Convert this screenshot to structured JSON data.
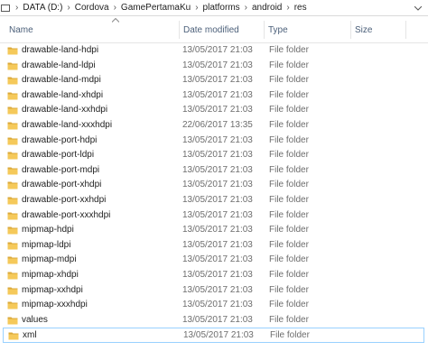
{
  "breadcrumb": [
    "DATA (D:)",
    "Cordova",
    "GamePertamaKu",
    "platforms",
    "android",
    "res"
  ],
  "columns": {
    "name": "Name",
    "date": "Date modified",
    "type": "Type",
    "size": "Size"
  },
  "rows": [
    {
      "name": "drawable-land-hdpi",
      "date": "13/05/2017 21:03",
      "type": "File folder"
    },
    {
      "name": "drawable-land-ldpi",
      "date": "13/05/2017 21:03",
      "type": "File folder"
    },
    {
      "name": "drawable-land-mdpi",
      "date": "13/05/2017 21:03",
      "type": "File folder"
    },
    {
      "name": "drawable-land-xhdpi",
      "date": "13/05/2017 21:03",
      "type": "File folder"
    },
    {
      "name": "drawable-land-xxhdpi",
      "date": "13/05/2017 21:03",
      "type": "File folder"
    },
    {
      "name": "drawable-land-xxxhdpi",
      "date": "22/06/2017 13:35",
      "type": "File folder"
    },
    {
      "name": "drawable-port-hdpi",
      "date": "13/05/2017 21:03",
      "type": "File folder"
    },
    {
      "name": "drawable-port-ldpi",
      "date": "13/05/2017 21:03",
      "type": "File folder"
    },
    {
      "name": "drawable-port-mdpi",
      "date": "13/05/2017 21:03",
      "type": "File folder"
    },
    {
      "name": "drawable-port-xhdpi",
      "date": "13/05/2017 21:03",
      "type": "File folder"
    },
    {
      "name": "drawable-port-xxhdpi",
      "date": "13/05/2017 21:03",
      "type": "File folder"
    },
    {
      "name": "drawable-port-xxxhdpi",
      "date": "13/05/2017 21:03",
      "type": "File folder"
    },
    {
      "name": "mipmap-hdpi",
      "date": "13/05/2017 21:03",
      "type": "File folder"
    },
    {
      "name": "mipmap-ldpi",
      "date": "13/05/2017 21:03",
      "type": "File folder"
    },
    {
      "name": "mipmap-mdpi",
      "date": "13/05/2017 21:03",
      "type": "File folder"
    },
    {
      "name": "mipmap-xhdpi",
      "date": "13/05/2017 21:03",
      "type": "File folder"
    },
    {
      "name": "mipmap-xxhdpi",
      "date": "13/05/2017 21:03",
      "type": "File folder"
    },
    {
      "name": "mipmap-xxxhdpi",
      "date": "13/05/2017 21:03",
      "type": "File folder"
    },
    {
      "name": "values",
      "date": "13/05/2017 21:03",
      "type": "File folder"
    },
    {
      "name": "xml",
      "date": "13/05/2017 21:03",
      "type": "File folder"
    }
  ],
  "icons": {
    "folder": "folder-icon",
    "sort": "sort-up-icon",
    "location": "this-pc-icon"
  },
  "colors": {
    "folder_fill": "#f5c95a",
    "folder_dark": "#dba93a",
    "header_text": "#4c607a",
    "selection_border": "#99d1ff"
  }
}
